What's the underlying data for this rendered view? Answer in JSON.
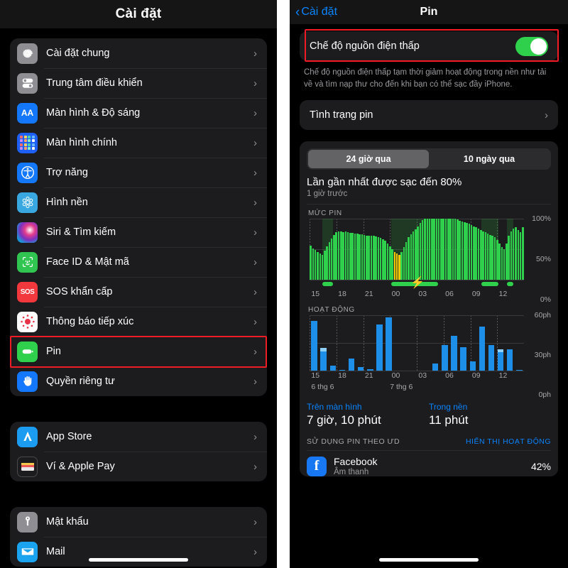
{
  "left": {
    "header_title": "Cài đặt",
    "groups": [
      {
        "items": [
          {
            "label": "Cài đặt chung",
            "icon": "gear-icon"
          },
          {
            "label": "Trung tâm điều khiển",
            "icon": "control-center-icon"
          },
          {
            "label": "Màn hình & Độ sáng",
            "icon": "display-brightness-icon"
          },
          {
            "label": "Màn hình chính",
            "icon": "home-screen-icon"
          },
          {
            "label": "Trợ năng",
            "icon": "accessibility-icon"
          },
          {
            "label": "Hình nền",
            "icon": "wallpaper-icon"
          },
          {
            "label": "Siri & Tìm kiếm",
            "icon": "siri-icon"
          },
          {
            "label": "Face ID & Mật mã",
            "icon": "face-id-icon"
          },
          {
            "label": "SOS khẩn cấp",
            "icon": "sos-icon"
          },
          {
            "label": "Thông báo tiếp xúc",
            "icon": "exposure-notification-icon"
          },
          {
            "label": "Pin",
            "icon": "battery-icon"
          },
          {
            "label": "Quyền riêng tư",
            "icon": "privacy-hand-icon"
          }
        ]
      },
      {
        "items": [
          {
            "label": "App Store",
            "icon": "app-store-icon"
          },
          {
            "label": "Ví & Apple Pay",
            "icon": "wallet-icon"
          }
        ]
      },
      {
        "items": [
          {
            "label": "Mật khẩu",
            "icon": "key-icon"
          },
          {
            "label": "Mail",
            "icon": "mail-icon"
          }
        ]
      }
    ]
  },
  "right": {
    "back_label": "Cài đặt",
    "header_title": "Pin",
    "low_power": {
      "label": "Chế độ nguồn điện thấp",
      "toggle_on": "true",
      "footnote": "Chế độ nguồn điện thấp tạm thời giảm hoạt động trong nền như tải về và tìm nạp thư cho đến khi bạn có thể sạc đầy iPhone."
    },
    "battery_health_label": "Tình trạng pin",
    "segments": [
      {
        "label": "24 giờ qua",
        "active": "true"
      },
      {
        "label": "10 ngày qua",
        "active": "false"
      }
    ],
    "last_charge_title": "Lần gần nhất được sạc đến 80%",
    "last_charge_sub": "1 giờ trước",
    "stats": [
      {
        "label": "Trên màn hình",
        "value": "7 giờ, 10 phút"
      },
      {
        "label": "Trong nền",
        "value": "11 phút"
      }
    ],
    "usage_title": "SỬ DỤNG PIN THEO ƯD",
    "usage_action": "HIỂN THỊ HOẠT ĐỘNG",
    "apps": [
      {
        "name": "Facebook",
        "sub": "Âm thanh",
        "pct": "42%",
        "icon": "facebook-icon"
      }
    ]
  },
  "colors": {
    "accent_blue": "#0a84ff",
    "battery_green": "#2fd14c",
    "charging_yellow": "#ffcc00",
    "activity_blue": "#1e8fe8",
    "highlight_red": "#ee1c25",
    "card_bg": "#1c1c1e"
  },
  "chart_data": [
    {
      "type": "bar",
      "title": "MỨC PIN",
      "ylabel": "",
      "xlabel": "",
      "ylim": [
        0,
        100
      ],
      "yticks": [
        "0%",
        "50%",
        "100%"
      ],
      "ytick_values": [
        0,
        50,
        100
      ],
      "xticks": [
        "15",
        "18",
        "21",
        "00",
        "03",
        "06",
        "09",
        "12"
      ],
      "grid": true,
      "legend": "none",
      "series": [
        {
          "name": "Mức pin",
          "values": [
            56,
            52,
            49,
            46,
            43,
            41,
            48,
            55,
            62,
            68,
            74,
            78,
            79,
            79,
            78,
            79,
            78,
            77,
            77,
            76,
            76,
            75,
            75,
            74,
            73,
            73,
            72,
            72,
            71,
            70,
            69,
            67,
            64,
            60,
            55,
            50,
            46,
            43,
            41,
            46,
            54,
            62,
            70,
            75,
            79,
            83,
            88,
            94,
            98,
            100,
            100,
            100,
            100,
            100,
            100,
            100,
            100,
            100,
            100,
            100,
            100,
            100,
            100,
            99,
            97,
            96,
            95,
            94,
            92,
            90,
            88,
            86,
            84,
            82,
            80,
            78,
            76,
            74,
            72,
            70,
            66,
            60,
            54,
            50,
            60,
            72,
            80,
            84,
            86,
            82,
            78,
            86
          ],
          "colors_by_index": {
            "36": "#ffcc00",
            "37": "#ffcc00",
            "38": "#ffcc00"
          }
        }
      ],
      "charging_periods": [
        {
          "start_pct": 6,
          "end_pct": 11
        },
        {
          "start_pct": 38,
          "end_pct": 60
        },
        {
          "start_pct": 80,
          "end_pct": 88
        },
        {
          "start_pct": 92,
          "end_pct": 95
        }
      ]
    },
    {
      "type": "bar",
      "title": "HOẠT ĐỘNG",
      "ylabel": "",
      "xlabel": "",
      "ylim": [
        0,
        60
      ],
      "yticks": [
        "0ph",
        "30ph",
        "60ph"
      ],
      "ytick_values": [
        0,
        30,
        60
      ],
      "xticks": [
        "15",
        "18",
        "21",
        "00",
        "03",
        "06",
        "09",
        "12"
      ],
      "day_labels": [
        "6 thg 6",
        "7 thg 6"
      ],
      "grid": true,
      "legend": "none",
      "series": [
        {
          "name": "Trên màn hình",
          "values": [
            54,
            21,
            6,
            1,
            13,
            4,
            2,
            50,
            58,
            0,
            0,
            0,
            0,
            8,
            28,
            38,
            26,
            10,
            48,
            28,
            20,
            23,
            1
          ]
        },
        {
          "name": "Trong nền",
          "values": [
            0,
            4,
            0,
            0,
            0,
            0,
            0,
            0,
            0,
            0,
            0,
            0,
            0,
            0,
            0,
            0,
            0,
            0,
            0,
            0,
            3,
            0,
            0
          ]
        }
      ]
    }
  ]
}
